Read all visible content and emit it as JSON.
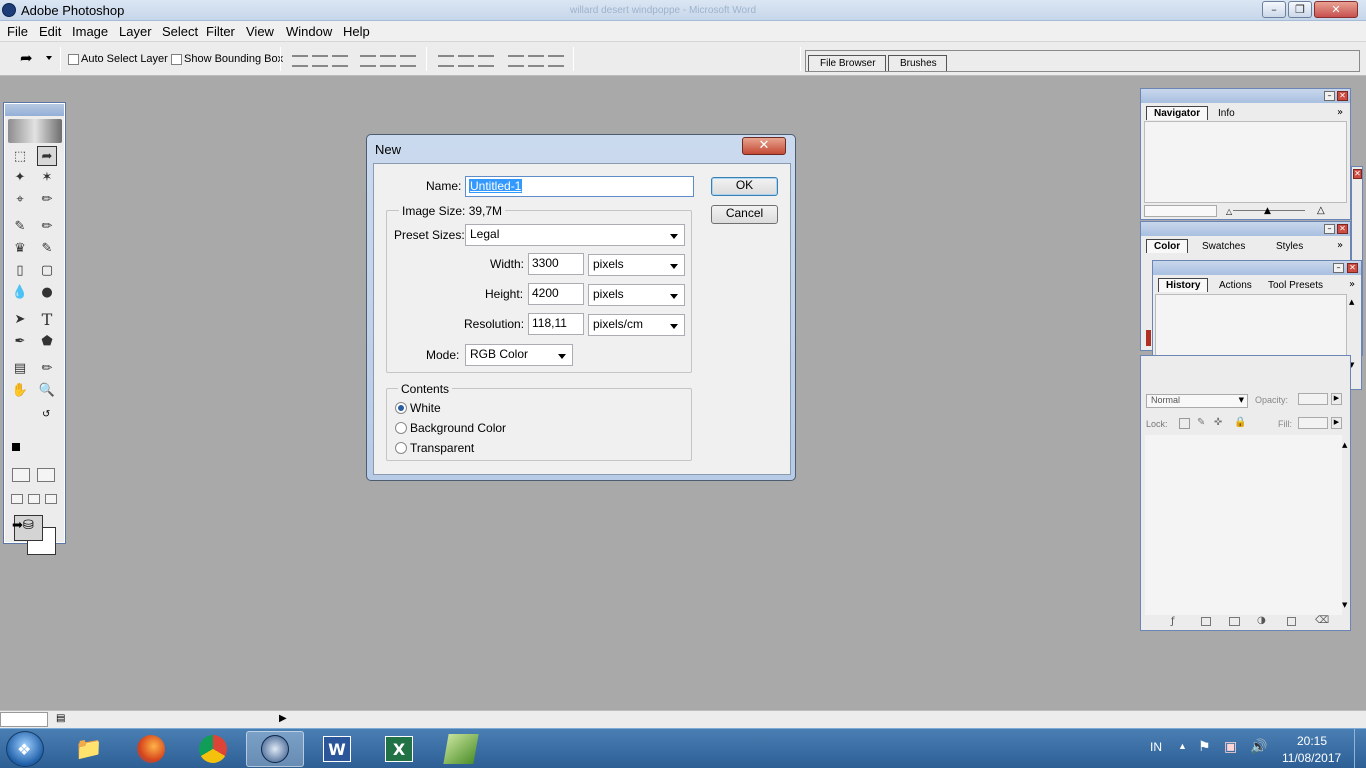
{
  "window": {
    "title": "Adobe Photoshop",
    "background_title": "willard desert windpoppe - Microsoft Word"
  },
  "menu": [
    "File",
    "Edit",
    "Image",
    "Layer",
    "Select",
    "Filter",
    "View",
    "Window",
    "Help"
  ],
  "options_bar": {
    "auto_select_label": "Auto Select Layer",
    "show_bounding_label": "Show Bounding Box",
    "well_tabs": [
      "File Browser",
      "Brushes"
    ]
  },
  "navigator_panel": {
    "tabs": [
      "Navigator",
      "Info"
    ]
  },
  "color_panel": {
    "tabs": [
      "Color",
      "Swatches",
      "Styles"
    ]
  },
  "history_panel": {
    "tabs": [
      "History",
      "Actions",
      "Tool Presets"
    ]
  },
  "layers_panel": {
    "blend_mode": "Normal",
    "opacity_label": "Opacity:",
    "lock_label": "Lock:",
    "fill_label": "Fill:"
  },
  "dialog": {
    "title": "New",
    "name_label": "Name:",
    "name_value": "Untitled-1",
    "image_size_label": "Image Size: 39,7M",
    "preset_label": "Preset Sizes:",
    "preset_value": "Legal",
    "width_label": "Width:",
    "width_value": "3300",
    "width_unit": "pixels",
    "height_label": "Height:",
    "height_value": "4200",
    "height_unit": "pixels",
    "resolution_label": "Resolution:",
    "resolution_value": "118,11",
    "resolution_unit": "pixels/cm",
    "mode_label": "Mode:",
    "mode_value": "RGB Color",
    "contents_label": "Contents",
    "contents_options": [
      "White",
      "Background Color",
      "Transparent"
    ],
    "contents_selected": "White",
    "ok_label": "OK",
    "cancel_label": "Cancel"
  },
  "taskbar": {
    "language": "IN",
    "time": "20:15",
    "date": "11/08/2017",
    "apps": [
      "windows-explorer",
      "firefox",
      "chrome",
      "photoshop",
      "word",
      "excel",
      "app-green"
    ],
    "active_app": "photoshop"
  },
  "colors": {
    "titlebar": "#c6d6ea",
    "workspace": "#a9a9a9",
    "selection": "#3399ff",
    "taskbar": "#2d5f95"
  }
}
